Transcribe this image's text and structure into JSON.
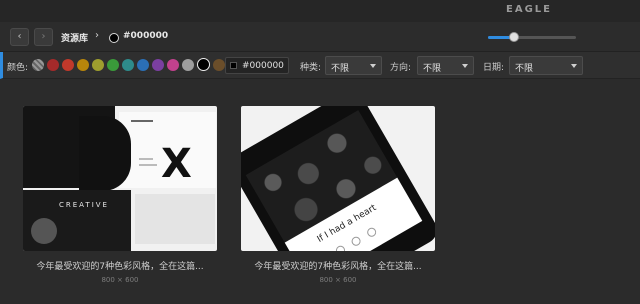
{
  "window": {
    "app_title": "EAGLE"
  },
  "toolbar": {
    "back_label": "‹",
    "forward_label": "›",
    "breadcrumb": "资源库",
    "breadcrumb_sep": "›",
    "current_color": "#000000",
    "zoom_value": 0.3
  },
  "filters": {
    "color_label": "颜色:",
    "swatches": [
      "none",
      "#a52a2a",
      "#c0392b",
      "#b8860b",
      "#9e9e2e",
      "#3a9a3a",
      "#2e8b8b",
      "#2b6fb5",
      "#7b3fa0",
      "#c2418d",
      "#9e9e9e",
      "#000000",
      "#6b4e2a"
    ],
    "selected_swatch": "#000000",
    "hex_value": "#000000",
    "type_label": "种类:",
    "type_value": "不限",
    "orientation_label": "方向:",
    "orientation_value": "不限",
    "date_label": "日期:",
    "date_value": "不限"
  },
  "items": [
    {
      "title": "今年最受欢迎的7种色彩风格，全在这篇...",
      "size": "800 × 600",
      "art_text": "CREATIVE"
    },
    {
      "title": "今年最受欢迎的7种色彩风格，全在这篇...",
      "size": "800 × 600",
      "art_text": "If I had a heart"
    }
  ]
}
